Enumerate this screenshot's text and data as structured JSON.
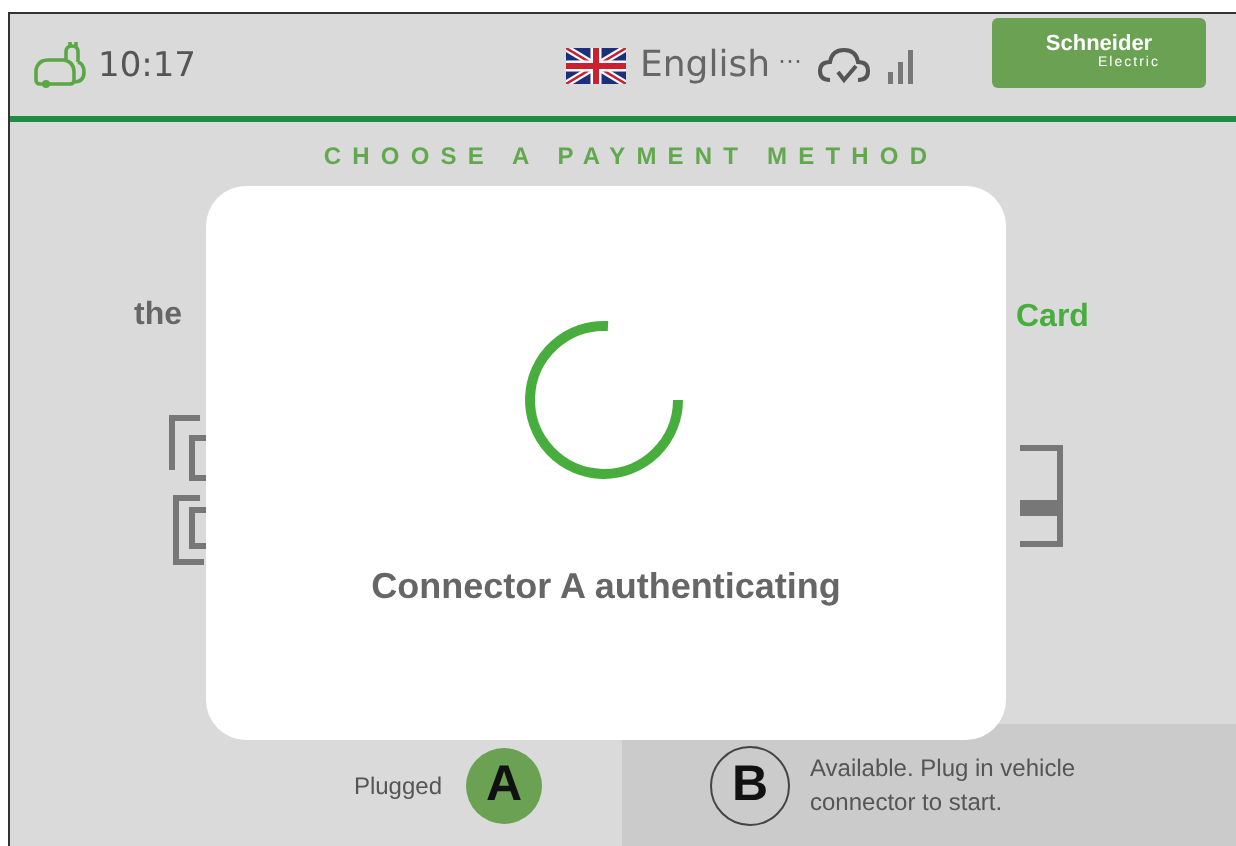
{
  "header": {
    "time": "10:17",
    "language": "English",
    "language_more": "···",
    "logo": {
      "line1": "Schneider",
      "line2": "Electric"
    }
  },
  "title": "CHOOSE A PAYMENT METHOD",
  "background": {
    "left_lines": [
      "the"
    ],
    "right_line": "Card"
  },
  "modal": {
    "message": "Connector A authenticating"
  },
  "connectors": [
    {
      "letter": "A",
      "status": "Plugged",
      "active": true
    },
    {
      "letter": "B",
      "status": "Available. Plug in vehicle connector to start.",
      "active": false
    }
  ]
}
